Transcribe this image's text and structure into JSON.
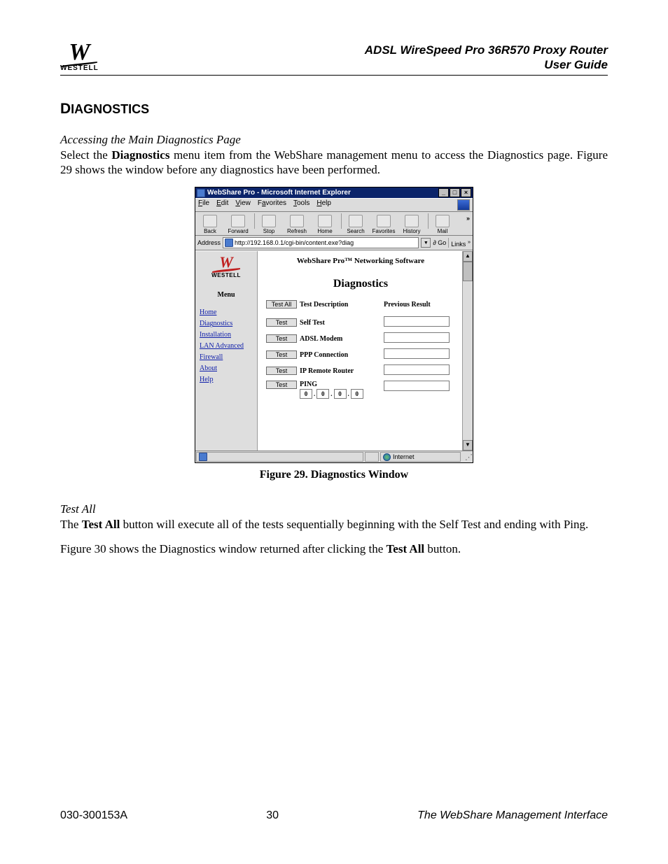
{
  "header": {
    "brand_logo_text": "W",
    "brand_name": "WESTELL",
    "doc_title_line1": "ADSL WireSpeed Pro 36R570 Proxy Router",
    "doc_title_line2": "User Guide"
  },
  "section_heading": {
    "first_letter": "D",
    "rest": "IAGNOSTICS"
  },
  "subheading1": "Accessing the Main Diagnostics Page",
  "para1_pre": "Select the ",
  "para1_bold": "Diagnostics",
  "para1_post": " menu item from the WebShare management menu to access the Diagnostics page.  Figure 29 shows the window before any diagnostics have been performed.",
  "figure_caption": "Figure 29.  Diagnostics Window",
  "subheading2": "Test All",
  "para2_pre": "The ",
  "para2_bold": "Test All",
  "para2_post": " button will execute all of the tests sequentially beginning with the Self Test and ending with Ping.",
  "para3_pre": "Figure 30 shows the Diagnostics window returned after clicking the ",
  "para3_bold": "Test All",
  "para3_post": " button.",
  "footer": {
    "left": "030-300153A",
    "center": "30",
    "right": "The WebShare Management Interface"
  },
  "browser": {
    "title": "WebShare Pro - Microsoft Internet Explorer",
    "menus": [
      "File",
      "Edit",
      "View",
      "Favorites",
      "Tools",
      "Help"
    ],
    "toolbar": [
      "Back",
      "Forward",
      "Stop",
      "Refresh",
      "Home",
      "Search",
      "Favorites",
      "History",
      "Mail"
    ],
    "address_label": "Address",
    "address_value": "http://192.168.0.1/cgi-bin/content.exe?diag",
    "go_label": "Go",
    "links_label": "Links",
    "sidebar": {
      "brand": "WESTELL",
      "menu_label": "Menu",
      "links": [
        "Home",
        "Diagnostics",
        "Installation",
        "LAN Advanced",
        "Firewall",
        "About",
        "Help"
      ]
    },
    "main": {
      "banner": "WebShare Pro™ Networking Software",
      "title": "Diagnostics",
      "header_btn": "Test All",
      "header_desc": "Test Description",
      "header_result": "Previous Result",
      "test_btn": "Test",
      "rows": [
        "Self Test",
        "ADSL Modem",
        "PPP Connection",
        "IP Remote Router",
        "PING"
      ],
      "ping_octets": [
        "0",
        "0",
        "0",
        "0"
      ]
    },
    "status_zone": "Internet"
  }
}
